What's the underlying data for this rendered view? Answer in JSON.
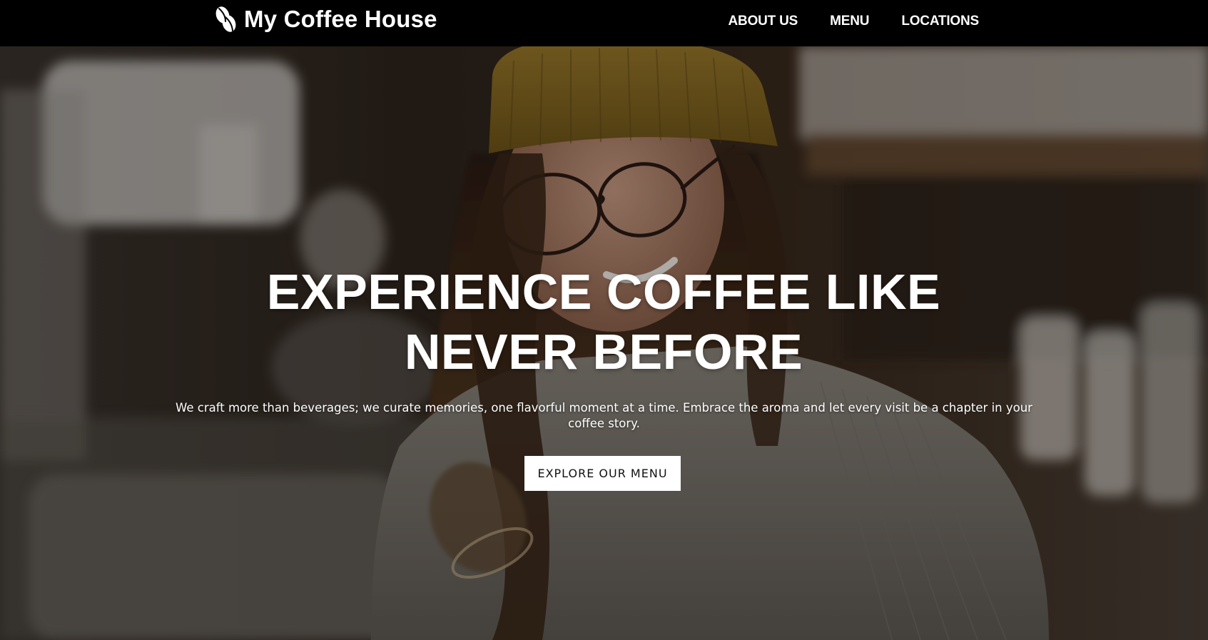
{
  "header": {
    "brand_name": "My Coffee House",
    "brand_icon": "coffee-beans-icon",
    "nav": [
      {
        "label": "ABOUT US"
      },
      {
        "label": "MENU"
      },
      {
        "label": "LOCATIONS"
      }
    ]
  },
  "hero": {
    "title": "EXPERIENCE COFFEE LIKE NEVER BEFORE",
    "text": "We craft more than beverages; we curate memories, one flavorful moment at a time. Embrace the aroma and let every visit be a chapter in your coffee story.",
    "button_label": "EXPLORE OUR MENU",
    "background_image": "cafe-barista-woman-photo"
  },
  "colors": {
    "nav_background": "#000000",
    "nav_text": "#ffffff",
    "button_background": "#ffffff",
    "button_text": "#111111",
    "hat_mustard": "#8a6b22"
  }
}
